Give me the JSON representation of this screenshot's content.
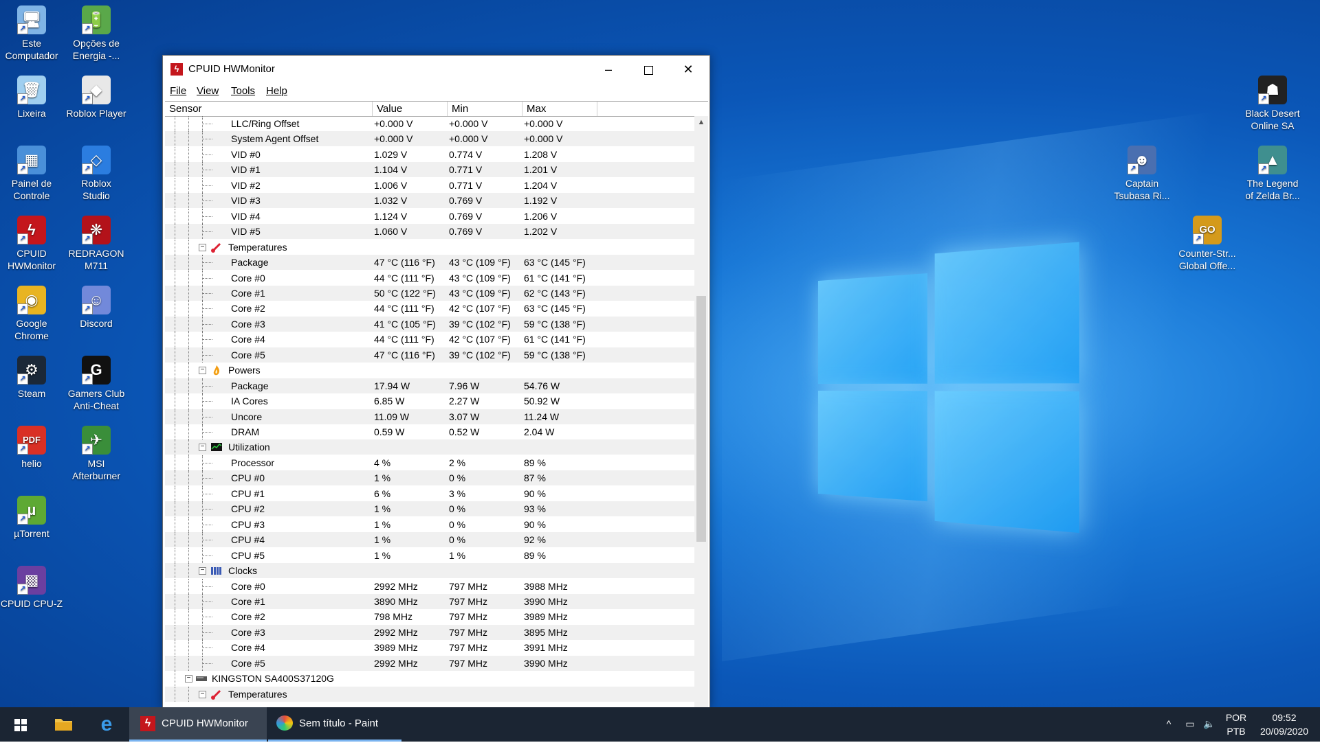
{
  "desktop": {
    "left_icons": [
      {
        "name": "este-computador-icon",
        "label1": "Este",
        "label2": "Computador",
        "glyph": "🖥",
        "bg": "#7fb4e6"
      },
      {
        "name": "opcoes-energia-icon",
        "label1": "Opções de",
        "label2": "Energia -...",
        "glyph": "🔋",
        "bg": "#5aa84a"
      },
      {
        "name": "lixeira-icon",
        "label1": "Lixeira",
        "label2": "",
        "glyph": "🗑",
        "bg": "#9fcff0"
      },
      {
        "name": "roblox-player-icon",
        "label1": "Roblox Player",
        "label2": "",
        "glyph": "◆",
        "bg": "#e8e8e8"
      },
      {
        "name": "painel-controle-icon",
        "label1": "Painel de",
        "label2": "Controle",
        "glyph": "▦",
        "bg": "#4a90d9"
      },
      {
        "name": "roblox-studio-icon",
        "label1": "Roblox",
        "label2": "Studio",
        "glyph": "◇",
        "bg": "#2b7de0"
      },
      {
        "name": "cpuid-hwmonitor-icon",
        "label1": "CPUID",
        "label2": "HWMonitor",
        "glyph": "ϟ",
        "bg": "#c4161c"
      },
      {
        "name": "redragon-icon",
        "label1": "REDRAGON",
        "label2": "M711",
        "glyph": "❋",
        "bg": "#b3121a"
      },
      {
        "name": "google-chrome-icon",
        "label1": "Google",
        "label2": "Chrome",
        "glyph": "◉",
        "bg": "#e8b422"
      },
      {
        "name": "discord-icon",
        "label1": "Discord",
        "label2": "",
        "glyph": "☺",
        "bg": "#7289da"
      },
      {
        "name": "steam-icon",
        "label1": "Steam",
        "label2": "",
        "glyph": "⚙",
        "bg": "#1b2838"
      },
      {
        "name": "gamers-club-icon",
        "label1": "Gamers Club",
        "label2": "Anti-Cheat",
        "glyph": "G",
        "bg": "#111"
      },
      {
        "name": "pdf-file-icon",
        "label1": "helio",
        "label2": "",
        "glyph": "PDF",
        "bg": "#d93025"
      },
      {
        "name": "msi-afterburner-icon",
        "label1": "MSI",
        "label2": "Afterburner",
        "glyph": "✈",
        "bg": "#3a8e3a"
      },
      {
        "name": "utorrent-icon",
        "label1": "µTorrent",
        "label2": "",
        "glyph": "µ",
        "bg": "#5ea934"
      },
      {
        "name": "cpuid-cpuz-icon",
        "label1": "CPUID CPU-Z",
        "label2": "",
        "glyph": "▩",
        "bg": "#6b3fa0"
      }
    ],
    "right_icons": [
      {
        "name": "black-desert-icon",
        "label1": "Black Desert",
        "label2": "Online SA",
        "glyph": "☗",
        "bg": "#222"
      },
      {
        "name": "captain-tsubasa-icon",
        "label1": "Captain",
        "label2": "Tsubasa Ri...",
        "glyph": "☻",
        "bg": "#4a6fb0"
      },
      {
        "name": "zelda-icon",
        "label1": "The Legend",
        "label2": "of Zelda Br...",
        "glyph": "▲",
        "bg": "#3f8f8f"
      },
      {
        "name": "counter-strike-icon",
        "label1": "Counter-Str...",
        "label2": "Global Offe...",
        "glyph": "GO",
        "bg": "#d49a1b"
      }
    ]
  },
  "window": {
    "title": "CPUID HWMonitor",
    "menu": [
      "File",
      "View",
      "Tools",
      "Help"
    ],
    "columns": [
      "Sensor",
      "Value",
      "Min",
      "Max"
    ],
    "rows": [
      {
        "level": 3,
        "sensor": "LLC/Ring Offset",
        "value": "+0.000 V",
        "min": "+0.000 V",
        "max": "+0.000 V"
      },
      {
        "level": 3,
        "sensor": "System Agent Offset",
        "value": "+0.000 V",
        "min": "+0.000 V",
        "max": "+0.000 V"
      },
      {
        "level": 3,
        "sensor": "VID #0",
        "value": "1.029 V",
        "min": "0.774 V",
        "max": "1.208 V"
      },
      {
        "level": 3,
        "sensor": "VID #1",
        "value": "1.104 V",
        "min": "0.771 V",
        "max": "1.201 V"
      },
      {
        "level": 3,
        "sensor": "VID #2",
        "value": "1.006 V",
        "min": "0.771 V",
        "max": "1.204 V"
      },
      {
        "level": 3,
        "sensor": "VID #3",
        "value": "1.032 V",
        "min": "0.769 V",
        "max": "1.192 V"
      },
      {
        "level": 3,
        "sensor": "VID #4",
        "value": "1.124 V",
        "min": "0.769 V",
        "max": "1.206 V"
      },
      {
        "level": 3,
        "sensor": "VID #5",
        "value": "1.060 V",
        "min": "0.769 V",
        "max": "1.202 V"
      },
      {
        "level": 2,
        "sensor": "Temperatures",
        "icon": "thermometer-icon",
        "value": "",
        "min": "",
        "max": ""
      },
      {
        "level": 3,
        "sensor": "Package",
        "value": "47 °C  (116 °F)",
        "min": "43 °C  (109 °F)",
        "max": "63 °C  (145 °F)"
      },
      {
        "level": 3,
        "sensor": "Core #0",
        "value": "44 °C  (111 °F)",
        "min": "43 °C  (109 °F)",
        "max": "61 °C  (141 °F)"
      },
      {
        "level": 3,
        "sensor": "Core #1",
        "value": "50 °C  (122 °F)",
        "min": "43 °C  (109 °F)",
        "max": "62 °C  (143 °F)"
      },
      {
        "level": 3,
        "sensor": "Core #2",
        "value": "44 °C  (111 °F)",
        "min": "42 °C  (107 °F)",
        "max": "63 °C  (145 °F)"
      },
      {
        "level": 3,
        "sensor": "Core #3",
        "value": "41 °C  (105 °F)",
        "min": "39 °C  (102 °F)",
        "max": "59 °C  (138 °F)"
      },
      {
        "level": 3,
        "sensor": "Core #4",
        "value": "44 °C  (111 °F)",
        "min": "42 °C  (107 °F)",
        "max": "61 °C  (141 °F)"
      },
      {
        "level": 3,
        "sensor": "Core #5",
        "value": "47 °C  (116 °F)",
        "min": "39 °C  (102 °F)",
        "max": "59 °C  (138 °F)"
      },
      {
        "level": 2,
        "sensor": "Powers",
        "icon": "flame-icon",
        "value": "",
        "min": "",
        "max": ""
      },
      {
        "level": 3,
        "sensor": "Package",
        "value": "17.94 W",
        "min": "7.96 W",
        "max": "54.76 W"
      },
      {
        "level": 3,
        "sensor": "IA Cores",
        "value": "6.85 W",
        "min": "2.27 W",
        "max": "50.92 W"
      },
      {
        "level": 3,
        "sensor": "Uncore",
        "value": "11.09 W",
        "min": "3.07 W",
        "max": "11.24 W"
      },
      {
        "level": 3,
        "sensor": "DRAM",
        "value": "0.59 W",
        "min": "0.52 W",
        "max": "2.04 W"
      },
      {
        "level": 2,
        "sensor": "Utilization",
        "icon": "utilization-icon",
        "value": "",
        "min": "",
        "max": ""
      },
      {
        "level": 3,
        "sensor": "Processor",
        "value": "4 %",
        "min": "2 %",
        "max": "89 %"
      },
      {
        "level": 3,
        "sensor": "CPU #0",
        "value": "1 %",
        "min": "0 %",
        "max": "87 %"
      },
      {
        "level": 3,
        "sensor": "CPU #1",
        "value": "6 %",
        "min": "3 %",
        "max": "90 %"
      },
      {
        "level": 3,
        "sensor": "CPU #2",
        "value": "1 %",
        "min": "0 %",
        "max": "93 %"
      },
      {
        "level": 3,
        "sensor": "CPU #3",
        "value": "1 %",
        "min": "0 %",
        "max": "90 %"
      },
      {
        "level": 3,
        "sensor": "CPU #4",
        "value": "1 %",
        "min": "0 %",
        "max": "92 %"
      },
      {
        "level": 3,
        "sensor": "CPU #5",
        "value": "1 %",
        "min": "1 %",
        "max": "89 %"
      },
      {
        "level": 2,
        "sensor": "Clocks",
        "icon": "clocks-icon",
        "value": "",
        "min": "",
        "max": ""
      },
      {
        "level": 3,
        "sensor": "Core #0",
        "value": "2992 MHz",
        "min": "797 MHz",
        "max": "3988 MHz"
      },
      {
        "level": 3,
        "sensor": "Core #1",
        "value": "3890 MHz",
        "min": "797 MHz",
        "max": "3990 MHz"
      },
      {
        "level": 3,
        "sensor": "Core #2",
        "value": "798 MHz",
        "min": "797 MHz",
        "max": "3989 MHz"
      },
      {
        "level": 3,
        "sensor": "Core #3",
        "value": "2992 MHz",
        "min": "797 MHz",
        "max": "3895 MHz"
      },
      {
        "level": 3,
        "sensor": "Core #4",
        "value": "3989 MHz",
        "min": "797 MHz",
        "max": "3991 MHz"
      },
      {
        "level": 3,
        "sensor": "Core #5",
        "value": "2992 MHz",
        "min": "797 MHz",
        "max": "3990 MHz"
      },
      {
        "level": 1,
        "sensor": "KINGSTON SA400S37120G",
        "icon": "drive-icon",
        "value": "",
        "min": "",
        "max": ""
      },
      {
        "level": 2,
        "sensor": "Temperatures",
        "icon": "thermometer-icon",
        "value": "",
        "min": "",
        "max": ""
      }
    ]
  },
  "taskbar": {
    "apps": [
      {
        "name": "taskbar-hwmonitor",
        "label": "CPUID HWMonitor"
      },
      {
        "name": "taskbar-paint",
        "label": "Sem título - Paint"
      }
    ],
    "lang1": "POR",
    "lang2": "PTB",
    "time": "09:52",
    "date": "20/09/2020"
  }
}
